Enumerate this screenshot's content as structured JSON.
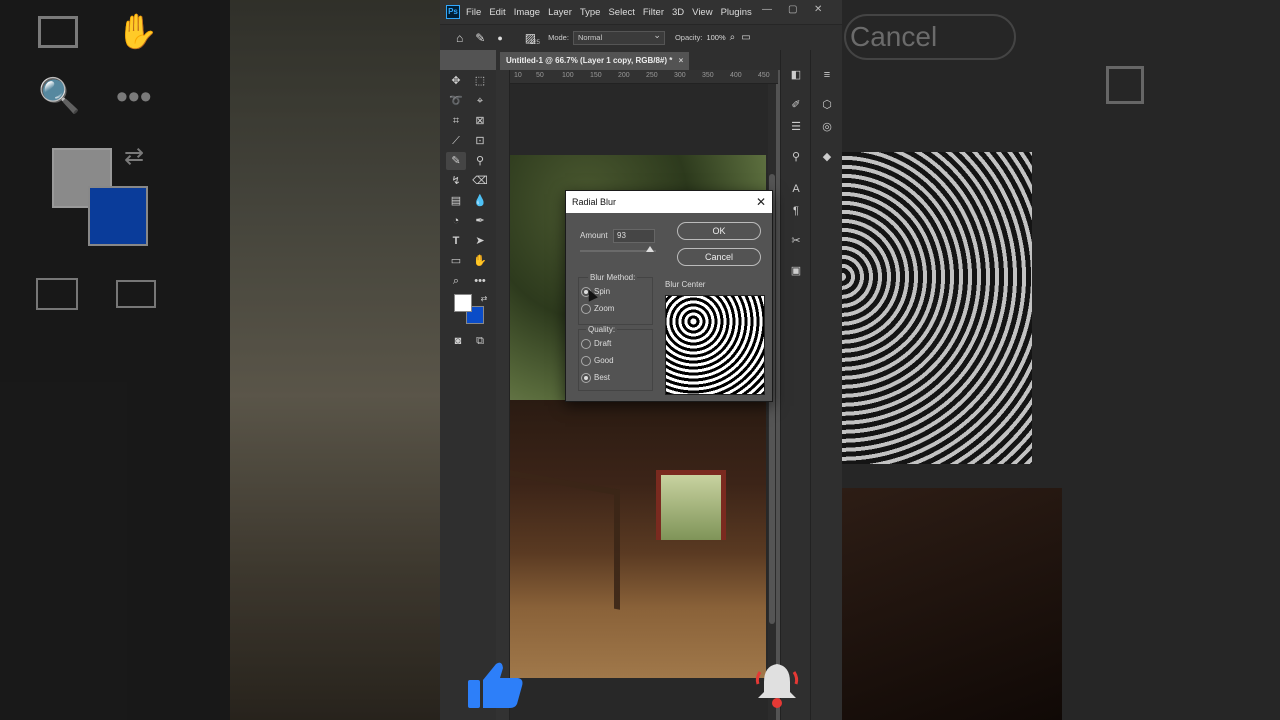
{
  "app": {
    "logo": "Ps",
    "menu": [
      "File",
      "Edit",
      "Image",
      "Layer",
      "Type",
      "Select",
      "Filter",
      "3D",
      "View",
      "Plugins"
    ]
  },
  "options_bar": {
    "brush_size": "125",
    "mode_label": "Mode:",
    "mode_value": "Normal",
    "opacity_label": "Opacity:",
    "opacity_value": "100%"
  },
  "document": {
    "tab_title": "Untitled-1 @ 66.7% (Layer 1 copy, RGB/8#) *",
    "ruler_ticks": [
      "10",
      "50",
      "100",
      "150",
      "200",
      "250",
      "300",
      "350",
      "400",
      "450"
    ]
  },
  "dialog": {
    "title": "Radial Blur",
    "amount_label": "Amount",
    "amount_value": "93",
    "ok_label": "OK",
    "cancel_label": "Cancel",
    "blur_method_label": "Blur Method:",
    "blur_methods": [
      "Spin",
      "Zoom"
    ],
    "selected_method": "Spin",
    "quality_label": "Quality:",
    "qualities": [
      "Draft",
      "Good",
      "Best"
    ],
    "selected_quality": "Best",
    "blur_center_label": "Blur Center"
  },
  "background": {
    "ghost_cancel": "Cancel"
  },
  "colors": {
    "foreground": "#ffffff",
    "background": "#0a4cc8",
    "like": "#2d7ff9",
    "bell": "#e0e0e0",
    "bell_accent": "#e53935"
  },
  "icons": {
    "like": "thumbs-up-icon",
    "bell": "notification-bell-icon"
  }
}
